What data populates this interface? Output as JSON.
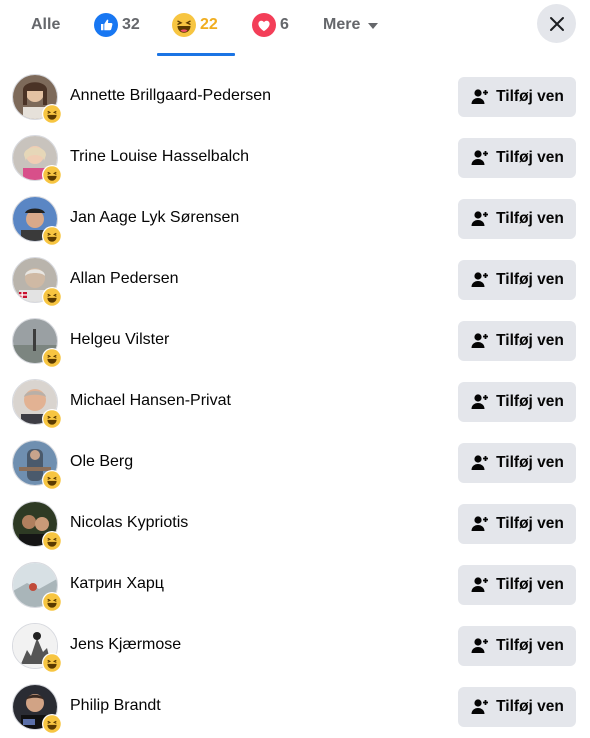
{
  "tabs": {
    "all_label": "Alle",
    "like_count": "32",
    "haha_count": "22",
    "love_count": "6",
    "more_label": "Mere"
  },
  "colors": {
    "active_accent": "#1b74e4",
    "haha_count_color": "#f0ad1f",
    "button_bg": "#e4e6eb"
  },
  "icons": {
    "like": "like-reaction-icon",
    "haha": "haha-reaction-icon",
    "love": "love-reaction-icon",
    "close": "close-icon",
    "add_friend": "add-friend-icon"
  },
  "add_friend_label": "Tilføj ven",
  "people": [
    {
      "name": "Annette Brillgaard-Pedersen"
    },
    {
      "name": "Trine Louise Hasselbalch"
    },
    {
      "name": "Jan Aage Lyk Sørensen"
    },
    {
      "name": "Allan Pedersen"
    },
    {
      "name": "Helgeu Vilster"
    },
    {
      "name": "Michael Hansen-Privat"
    },
    {
      "name": "Ole Berg"
    },
    {
      "name": "Nicolas Kypriotis"
    },
    {
      "name": "Катрин Харц"
    },
    {
      "name": "Jens Kjærmose"
    },
    {
      "name": "Philip Brandt"
    }
  ]
}
